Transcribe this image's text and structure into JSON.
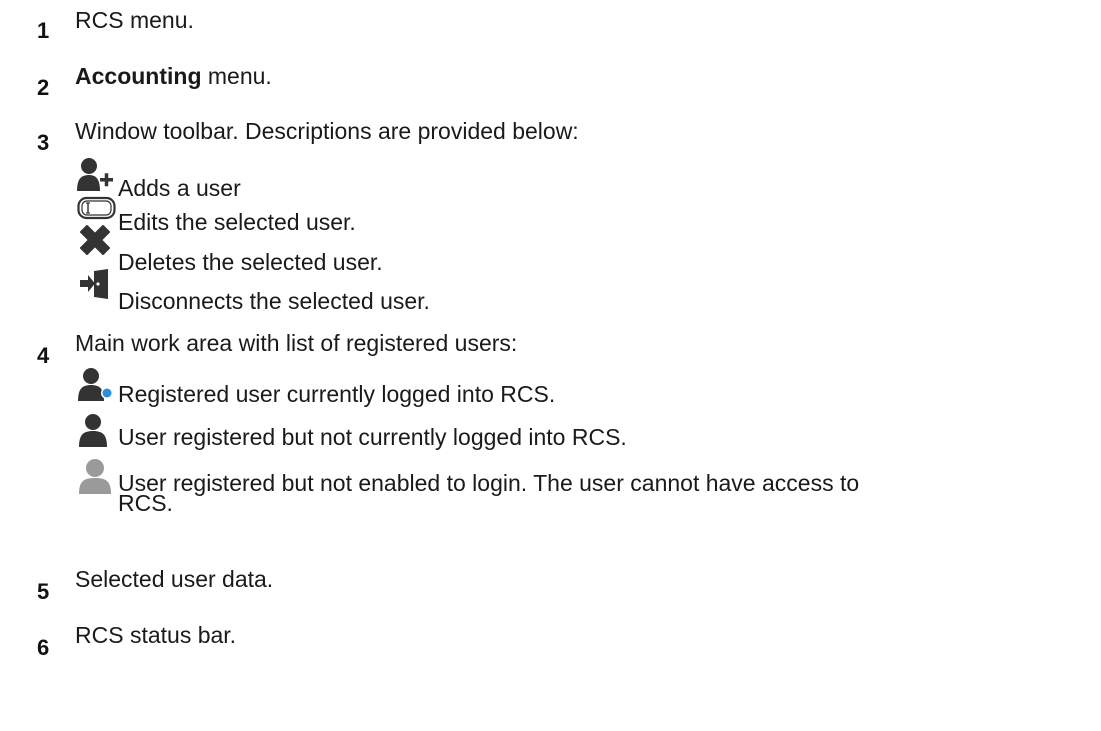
{
  "items": [
    {
      "num": "1",
      "text": "RCS menu."
    },
    {
      "num": "2",
      "bold": "Accounting",
      "rest": " menu."
    },
    {
      "num": "3",
      "text": "Window toolbar. Descriptions are provided below:"
    },
    {
      "num": "4",
      "text": "Main work area with list of registered users:"
    },
    {
      "num": "5",
      "text": "Selected user data."
    },
    {
      "num": "6",
      "text": "RCS status bar."
    }
  ],
  "toolbar_icons": [
    {
      "icon": "add-user-icon",
      "text": "Adds a user"
    },
    {
      "icon": "edit-icon",
      "text": "Edits the selected user."
    },
    {
      "icon": "delete-icon",
      "text": "Deletes the selected user."
    },
    {
      "icon": "disconnect-icon",
      "text": "Disconnects the selected user."
    }
  ],
  "user_states": [
    {
      "icon": "user-logged-in-icon",
      "text": "Registered user currently logged into RCS."
    },
    {
      "icon": "user-registered-icon",
      "text": "User registered but not currently logged into RCS."
    },
    {
      "icon": "user-disabled-icon",
      "text_line1": "User registered but not enabled to login. The user cannot have access to",
      "text_line2": "RCS."
    }
  ],
  "colors": {
    "icon_dark": "#333333",
    "icon_disabled": "#9a9a9a",
    "online_dot": "#2a8fd8"
  }
}
